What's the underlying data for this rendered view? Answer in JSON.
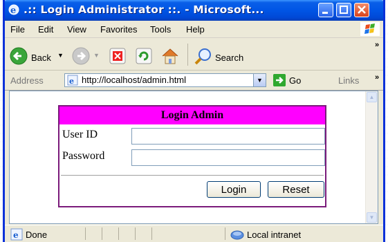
{
  "window": {
    "title": ".:: Login Administrator ::. - Microsoft..."
  },
  "menu": {
    "file": "File",
    "edit": "Edit",
    "view": "View",
    "favorites": "Favorites",
    "tools": "Tools",
    "help": "Help"
  },
  "toolbar": {
    "back": "Back",
    "search": "Search",
    "more": "»"
  },
  "address": {
    "label": "Address",
    "url": "http://localhost/admin.html",
    "go": "Go",
    "links": "Links",
    "more": "»"
  },
  "login": {
    "heading": "Login Admin",
    "user_label": "User ID",
    "password_label": "Password",
    "user_value": "",
    "password_value": "",
    "login_button": "Login",
    "reset_button": "Reset"
  },
  "status": {
    "text": "Done",
    "zone": "Local intranet"
  },
  "colors": {
    "header_bg": "#ff00ff",
    "box_border": "#7a1a7a",
    "titlebar": "#0055e5"
  }
}
